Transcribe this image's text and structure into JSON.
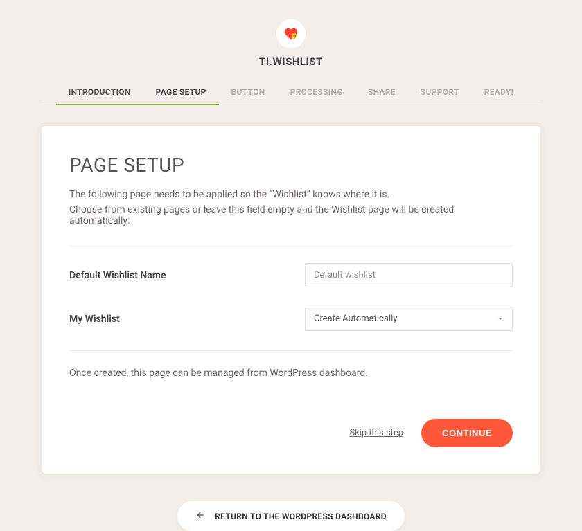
{
  "brand": {
    "title": "TI.WISHLIST"
  },
  "tabs": [
    {
      "label": "INTRODUCTION",
      "state": "done"
    },
    {
      "label": "PAGE SETUP",
      "state": "active"
    },
    {
      "label": "BUTTON",
      "state": "pending"
    },
    {
      "label": "PROCESSING",
      "state": "pending"
    },
    {
      "label": "SHARE",
      "state": "pending"
    },
    {
      "label": "SUPPORT",
      "state": "pending"
    },
    {
      "label": "READY!",
      "state": "pending"
    }
  ],
  "page": {
    "title": "PAGE SETUP",
    "intro_line1": "The following page needs to be applied so the “Wishlist” knows where it is.",
    "intro_line2": "Choose from existing pages or leave this field empty and the Wishlist page will be created automatically:",
    "fields": {
      "default_wishlist_name": {
        "label": "Default Wishlist Name",
        "value": "Default wishlist"
      },
      "my_wishlist": {
        "label": "My Wishlist",
        "selected": "Create Automatically"
      }
    },
    "note": "Once created, this page can be managed from WordPress dashboard."
  },
  "actions": {
    "skip_label": "Skip this step",
    "continue_label": "CONTINUE"
  },
  "footer": {
    "return_label": "RETURN TO THE WORDPRESS DASHBOARD"
  },
  "colors": {
    "accent_green": "#96b846",
    "accent_orange": "#ff5739",
    "background": "#f3eee9"
  }
}
